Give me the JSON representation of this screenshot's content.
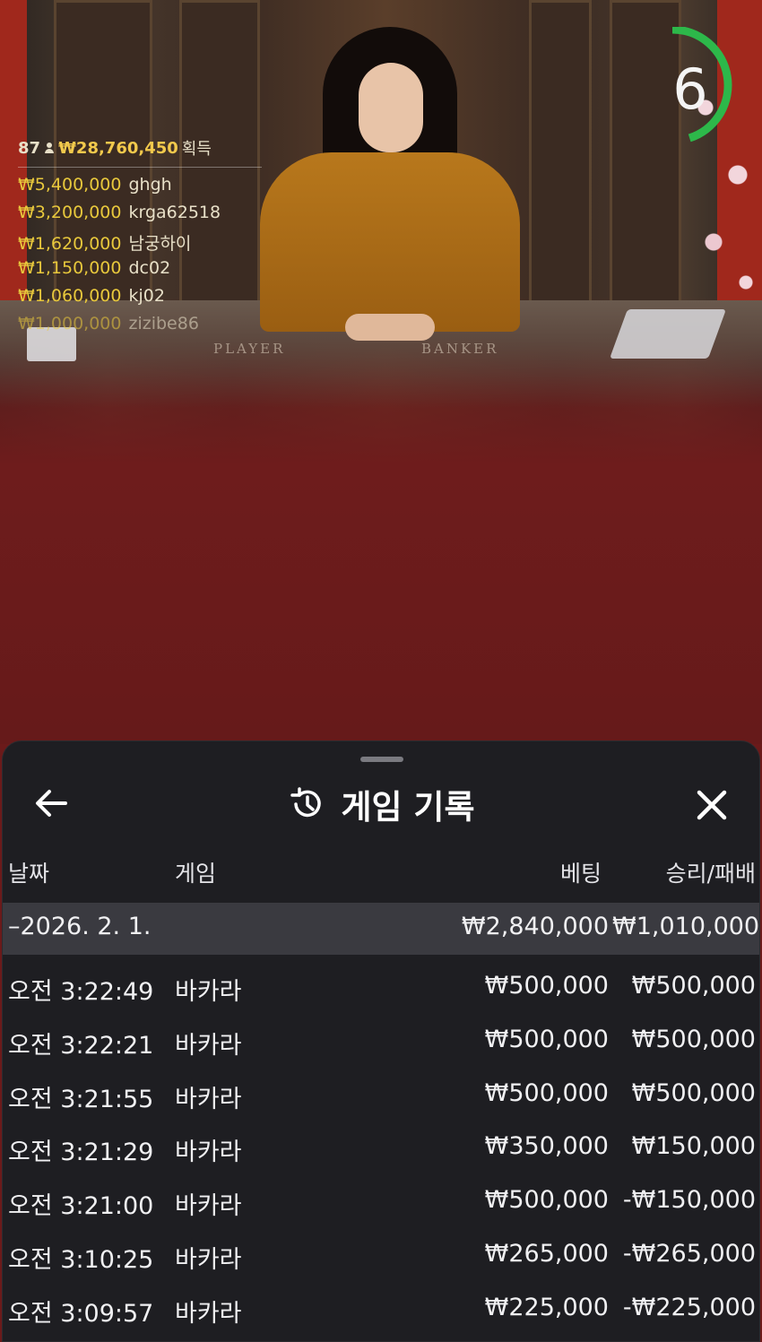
{
  "overlay": {
    "player_count": "87",
    "total_won": "₩28,760,450",
    "total_won_word": "획득",
    "winners": [
      {
        "amount": "₩5,400,000",
        "name": "ghgh"
      },
      {
        "amount": "₩3,200,000",
        "name": "krga62518"
      },
      {
        "amount": "₩1,620,000",
        "name": "남궁하이"
      },
      {
        "amount": "₩1,150,000",
        "name": "dc02"
      },
      {
        "amount": "₩1,060,000",
        "name": "kj02"
      },
      {
        "amount": "₩1,000,000",
        "name": "zizibe86"
      }
    ],
    "table_labels": {
      "player": "PLAYER",
      "banker": "BANKER"
    },
    "countdown": {
      "value": "6",
      "remaining_fraction": 0.45,
      "color": "#2db84a"
    }
  },
  "sheet": {
    "title": "게임 기록",
    "columns": {
      "date": "날짜",
      "game": "게임",
      "bet": "베팅",
      "result": "승리/패배"
    },
    "date_group": {
      "date": "2026. 2. 1.",
      "total_bet": "₩2,840,000",
      "total_result": "₩1,010,000"
    },
    "rows": [
      {
        "time": "오전 3:22:49",
        "game": "바카라",
        "bet": "₩500,000",
        "result": "₩500,000"
      },
      {
        "time": "오전 3:22:21",
        "game": "바카라",
        "bet": "₩500,000",
        "result": "₩500,000"
      },
      {
        "time": "오전 3:21:55",
        "game": "바카라",
        "bet": "₩500,000",
        "result": "₩500,000"
      },
      {
        "time": "오전 3:21:29",
        "game": "바카라",
        "bet": "₩350,000",
        "result": "₩150,000"
      },
      {
        "time": "오전 3:21:00",
        "game": "바카라",
        "bet": "₩500,000",
        "result": "-₩150,000"
      },
      {
        "time": "오전 3:10:25",
        "game": "바카라",
        "bet": "₩265,000",
        "result": "-₩265,000"
      },
      {
        "time": "오전 3:09:57",
        "game": "바카라",
        "bet": "₩225,000",
        "result": "-₩225,000"
      }
    ]
  },
  "colors": {
    "accent_gold": "#f2c94c",
    "sheet_bg": "#1e1e22",
    "group_row_bg": "#3a3a40"
  }
}
